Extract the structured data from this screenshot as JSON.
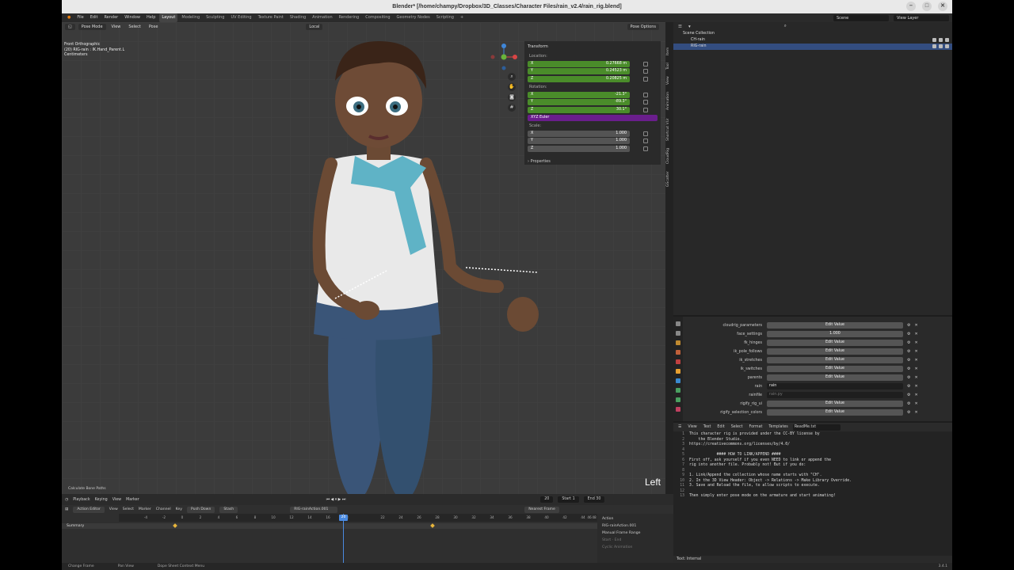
{
  "window": {
    "title": "Blender* [/home/champy/Dropbox/3D_Classes/Character Files/rain_v2.4/rain_rig.blend]",
    "controls": [
      "–",
      "□",
      "✕"
    ]
  },
  "menu": [
    "File",
    "Edit",
    "Render",
    "Window",
    "Help"
  ],
  "workspaces": [
    "Layout",
    "Modeling",
    "Sculpting",
    "UV Editing",
    "Texture Paint",
    "Shading",
    "Animation",
    "Rendering",
    "Compositing",
    "Geometry Nodes",
    "Scripting",
    "+"
  ],
  "active_workspace": "Layout",
  "scene": "Scene",
  "view_layer": "View Layer",
  "viewport": {
    "mode": "Pose Mode",
    "menus": [
      "View",
      "Select",
      "Pose"
    ],
    "transform_space": "Local",
    "pose_options": "Pose Options",
    "info": [
      "Front Orthographic",
      "(20) RIG-rain : IK.Hand_Parent.L",
      "Centimeters"
    ],
    "side_label": "Left",
    "calc_button": "Calculate Bone Paths"
  },
  "npanel": {
    "title": "Transform",
    "location_label": "Location:",
    "location": [
      {
        "axis": "X",
        "value": "0.27668 m"
      },
      {
        "axis": "Y",
        "value": "0.24523 m"
      },
      {
        "axis": "Z",
        "value": "0.20825 m"
      }
    ],
    "rotation_label": "Rotation:",
    "rotation": [
      {
        "axis": "X",
        "value": "-21.3°"
      },
      {
        "axis": "Y",
        "value": "-89.3°"
      },
      {
        "axis": "Z",
        "value": "30.1°"
      }
    ],
    "rotation_mode": "XYZ Euler",
    "scale_label": "Scale:",
    "scale": [
      {
        "axis": "X",
        "value": "1.000"
      },
      {
        "axis": "Y",
        "value": "1.000"
      },
      {
        "axis": "Z",
        "value": "1.000"
      }
    ],
    "properties": "Properties"
  },
  "side_tabs": [
    "Item",
    "Tool",
    "View",
    "Animation",
    "Shortcut VUr",
    "CloudRig",
    "GScatter"
  ],
  "outliner": {
    "rows": [
      {
        "label": "Scene Collection",
        "selected": false
      },
      {
        "label": "CH-rain",
        "selected": false
      },
      {
        "label": "RIG-rain",
        "selected": true
      }
    ]
  },
  "properties": {
    "rows": [
      {
        "label": "cloudrig_parameters",
        "value": "Edit Value",
        "text": false
      },
      {
        "label": "face_settings",
        "value": "1.000",
        "text": false
      },
      {
        "label": "fk_hinges",
        "value": "Edit Value",
        "text": false
      },
      {
        "label": "ik_pole_follows",
        "value": "Edit Value",
        "text": false
      },
      {
        "label": "ik_stretches",
        "value": "Edit Value",
        "text": false
      },
      {
        "label": "ik_switches",
        "value": "Edit Value",
        "text": false
      },
      {
        "label": "parents",
        "value": "Edit Value",
        "text": false
      },
      {
        "label": "rain",
        "value": "rain",
        "text": true
      },
      {
        "label": "rainfile",
        "value": "rain.py",
        "text": true
      },
      {
        "label": "rigify_rig_ui",
        "value": "Edit Value",
        "text": false
      },
      {
        "label": "rigify_selection_colors",
        "value": "Edit Value",
        "text": false
      }
    ]
  },
  "text_editor": {
    "menus": [
      "View",
      "Text",
      "Edit",
      "Select",
      "Format",
      "Templates"
    ],
    "filename": "ReadMe.txt",
    "lines": [
      "This character rig is provided under the CC-BY license by",
      "    the Blender Studio.",
      "https://creativecommons.org/licenses/by/4.0/",
      "",
      "            #### HOW TO LINK/APPEND ####",
      "First off, ask yourself if you even NEED to link or append the",
      "rig into another file. Probably not! But if you do:",
      "",
      "1. Link/Append the collection whose name starts with \"CH\".",
      "2. In the 3D View Header: Object -> Relations -> Make Library Override.",
      "3. Save and Reload the file, to allow scripts to execute.",
      "",
      "Then simply enter pose mode on the armature and start animating!"
    ],
    "footer": "Text: Internal"
  },
  "timeline": {
    "menus": [
      "Playback",
      "Keying",
      "View",
      "Marker"
    ],
    "current_frame": "20",
    "start_label": "Start",
    "start": "1",
    "end_label": "End",
    "end": "30"
  },
  "action_editor": {
    "mode": "Action Editor",
    "menus": [
      "View",
      "Select",
      "Marker",
      "Channel",
      "Key"
    ],
    "push_down": "Push Down",
    "stash": "Stash",
    "action_name": "RIG-rainAction.001",
    "sort": "Nearest Frame",
    "summary": "Summary",
    "ticks": [
      "-4",
      "-2",
      "0",
      "2",
      "4",
      "6",
      "8",
      "10",
      "12",
      "14",
      "16",
      "18",
      "22",
      "24",
      "26",
      "28",
      "30",
      "32",
      "34",
      "36",
      "38",
      "40",
      "42",
      "44",
      "46",
      "48"
    ],
    "playhead": "20",
    "side_title": "Action",
    "side_action": "RIG-rainAction.001",
    "manual_range": "Manual Frame Range",
    "start": "Start",
    "end": "End",
    "cyclic": "Cyclic Animation"
  },
  "status_bar": [
    "Change Frame",
    "Pan View",
    "Dope Sheet Context Menu",
    "3.4.1"
  ],
  "colors": {
    "green_field": "#4a8c2a",
    "purple_field": "#6a1e8c",
    "selection": "#334d80",
    "playhead": "#4a8ae0",
    "keyframe": "#e8b53b"
  }
}
